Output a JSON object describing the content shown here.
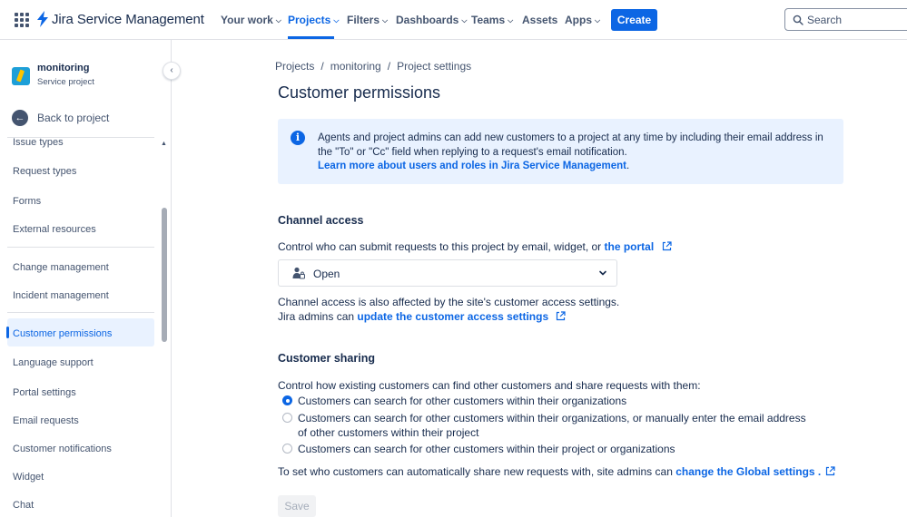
{
  "topnav": {
    "product_name": "Jira Service Management",
    "items": [
      {
        "label": "Your work",
        "has_chevron": true
      },
      {
        "label": "Projects",
        "has_chevron": true,
        "active": true
      },
      {
        "label": "Filters",
        "has_chevron": true
      },
      {
        "label": "Dashboards",
        "has_chevron": true
      },
      {
        "label": "Teams",
        "has_chevron": true
      },
      {
        "label": "Assets",
        "has_chevron": false
      },
      {
        "label": "Apps",
        "has_chevron": true
      }
    ],
    "create_label": "Create",
    "search_placeholder": "Search",
    "accent_color": "#0c66e4"
  },
  "sidebar": {
    "project_name": "monitoring",
    "project_type": "Service project",
    "back_label": "Back to project",
    "items": [
      {
        "label": "Issue types"
      },
      {
        "label": "Request types"
      },
      {
        "label": "Forms"
      },
      {
        "label": "External resources"
      },
      {
        "label": "Change management"
      },
      {
        "label": "Incident management"
      },
      {
        "label": "Customer permissions",
        "active": true
      },
      {
        "label": "Language support"
      },
      {
        "label": "Portal settings"
      },
      {
        "label": "Email requests"
      },
      {
        "label": "Customer notifications"
      },
      {
        "label": "Widget"
      },
      {
        "label": "Chat"
      }
    ]
  },
  "breadcrumbs": [
    "Projects",
    "monitoring",
    "Project settings"
  ],
  "page_title": "Customer permissions",
  "info_panel": {
    "text": "Agents and project admins can add new customers to a project at any time by including their email address in the \"To\" or \"Cc\" field when replying to a request's email notification.",
    "link": "Learn more about users and roles in Jira Service Management",
    "link_suffix": "."
  },
  "channel_access": {
    "title": "Channel access",
    "description": "Control who can submit requests to this project by email, widget, or",
    "portal_link": "the portal",
    "selected_value": "Open",
    "note_line1": "Channel access is also affected by the site's customer access settings.",
    "note_line2_prefix": "Jira admins can",
    "note_line2_link": "update the customer access settings"
  },
  "customer_sharing": {
    "title": "Customer sharing",
    "description": "Control how existing customers can find other customers and share requests with them:",
    "options": [
      {
        "label": "Customers can search for other customers within their organizations",
        "checked": true
      },
      {
        "label": "Customers can search for other customers within their organizations, or manually enter the email address of other customers within their project",
        "checked": false
      },
      {
        "label": "Customers can search for other customers within their project or organizations",
        "checked": false
      }
    ],
    "footer_prefix": "To set who customers can automatically share new requests with, site admins can",
    "footer_link": "change the Global settings ."
  },
  "save_label": "Save"
}
